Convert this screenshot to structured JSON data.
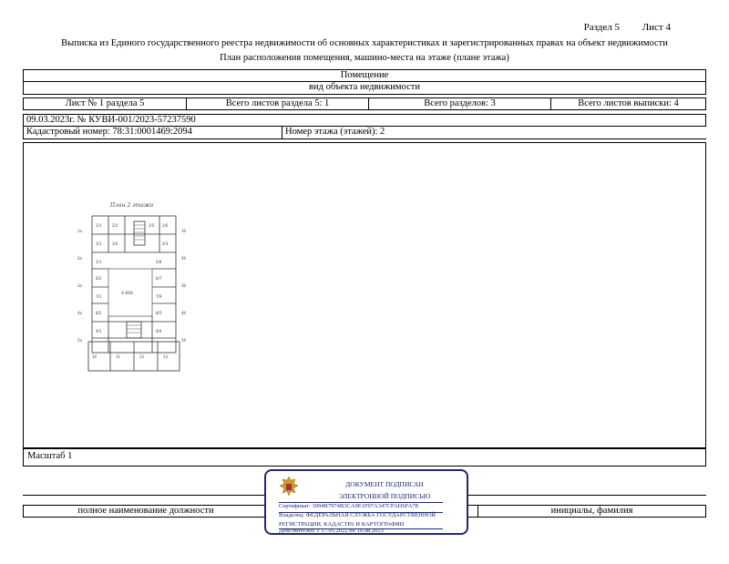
{
  "header": {
    "section": "Раздел 5",
    "sheet": "Лист 4",
    "title": "Выписка из Единого государственного реестра недвижимости об основных характеристиках и зарегистрированных правах на объект недвижимости",
    "subtitle": "План расположения помещения, машино-места на этаже (плане этажа)"
  },
  "object": {
    "type": "Помещение",
    "type_caption": "вид объекта недвижимости"
  },
  "sheets_row": {
    "sheet_section": "Лист № 1 раздела 5",
    "total_section_sheets": "Всего листов раздела 5: 1",
    "total_sections": "Всего разделов: 3",
    "total_extract_sheets": "Всего листов выписки: 4"
  },
  "doc_ref": "09.03.2023г. № КУВИ-001/2023-57237590",
  "cadastral": "Кадастровый номер: 78:31:0001469:2094",
  "floor": "Номер этажа (этажей): 2",
  "plan": {
    "caption": "План 2 этажа",
    "area_label": "4-666"
  },
  "scale": "Масштаб 1",
  "signature": {
    "position_label": "полное наименование должности",
    "initials_label": "инициалы, фамилия"
  },
  "stamp": {
    "line1": "ДОКУМЕНТ ПОДПИСАН",
    "line2": "ЭЛЕКТРОННОЙ ПОДПИСЬЮ",
    "cert": "Сертификат: 3094B7974B3CA9E1F07A347CFAD6FA78",
    "owner1": "Владелец: ФЕДЕРАЛЬНАЯ СЛУЖБА ГОСУДАРСТВЕННОЙ",
    "owner2": "РЕГИСТРАЦИИ, КАДАСТРА И КАРТОГРАФИИ",
    "valid": "Действителен: с 17.05.2022 по 10.08.2023",
    "color": "#1f2a6e"
  }
}
